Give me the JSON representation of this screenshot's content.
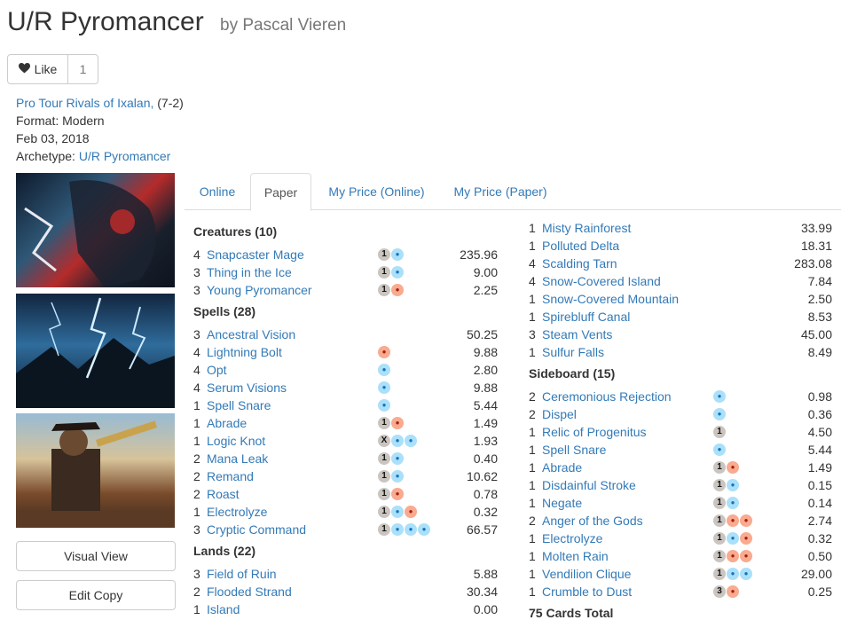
{
  "deck": {
    "title": "U/R Pyromancer",
    "byline": "by Pascal Vieren",
    "like_label": "Like",
    "like_count": "1"
  },
  "meta": {
    "event": "Pro Tour Rivals of Ixalan,",
    "record": "(7-2)",
    "format": "Format: Modern",
    "date": "Feb 03, 2018",
    "archetype_label": "Archetype:",
    "archetype": "U/R Pyromancer"
  },
  "sidebar": {
    "visual_view": "Visual View",
    "edit_copy": "Edit Copy"
  },
  "tabs": [
    "Online",
    "Paper",
    "My Price (Online)",
    "My Price (Paper)"
  ],
  "left_column": [
    {
      "title": "Creatures (10)",
      "cards": [
        {
          "qty": "4",
          "name": "Snapcaster Mage",
          "price": "235.96",
          "mana": [
            {
              "k": "g",
              "t": "1"
            },
            {
              "k": "u",
              "t": "💧"
            }
          ]
        },
        {
          "qty": "3",
          "name": "Thing in the Ice",
          "price": "9.00",
          "mana": [
            {
              "k": "g",
              "t": "1"
            },
            {
              "k": "u",
              "t": "💧"
            }
          ]
        },
        {
          "qty": "3",
          "name": "Young Pyromancer",
          "price": "2.25",
          "mana": [
            {
              "k": "g",
              "t": "1"
            },
            {
              "k": "r",
              "t": "🔥"
            }
          ]
        }
      ]
    },
    {
      "title": "Spells (28)",
      "cards": [
        {
          "qty": "3",
          "name": "Ancestral Vision",
          "price": "50.25",
          "mana": []
        },
        {
          "qty": "4",
          "name": "Lightning Bolt",
          "price": "9.88",
          "mana": [
            {
              "k": "r",
              "t": "🔥"
            }
          ]
        },
        {
          "qty": "4",
          "name": "Opt",
          "price": "2.80",
          "mana": [
            {
              "k": "u",
              "t": "💧"
            }
          ]
        },
        {
          "qty": "4",
          "name": "Serum Visions",
          "price": "9.88",
          "mana": [
            {
              "k": "u",
              "t": "💧"
            }
          ]
        },
        {
          "qty": "1",
          "name": "Spell Snare",
          "price": "5.44",
          "mana": [
            {
              "k": "u",
              "t": "💧"
            }
          ]
        },
        {
          "qty": "1",
          "name": "Abrade",
          "price": "1.49",
          "mana": [
            {
              "k": "g",
              "t": "1"
            },
            {
              "k": "r",
              "t": "🔥"
            }
          ]
        },
        {
          "qty": "1",
          "name": "Logic Knot",
          "price": "1.93",
          "mana": [
            {
              "k": "g",
              "t": "X"
            },
            {
              "k": "u",
              "t": "💧"
            },
            {
              "k": "u",
              "t": "💧"
            }
          ]
        },
        {
          "qty": "2",
          "name": "Mana Leak",
          "price": "0.40",
          "mana": [
            {
              "k": "g",
              "t": "1"
            },
            {
              "k": "u",
              "t": "💧"
            }
          ]
        },
        {
          "qty": "2",
          "name": "Remand",
          "price": "10.62",
          "mana": [
            {
              "k": "g",
              "t": "1"
            },
            {
              "k": "u",
              "t": "💧"
            }
          ]
        },
        {
          "qty": "2",
          "name": "Roast",
          "price": "0.78",
          "mana": [
            {
              "k": "g",
              "t": "1"
            },
            {
              "k": "r",
              "t": "🔥"
            }
          ]
        },
        {
          "qty": "1",
          "name": "Electrolyze",
          "price": "0.32",
          "mana": [
            {
              "k": "g",
              "t": "1"
            },
            {
              "k": "u",
              "t": "💧"
            },
            {
              "k": "r",
              "t": "🔥"
            }
          ]
        },
        {
          "qty": "3",
          "name": "Cryptic Command",
          "price": "66.57",
          "mana": [
            {
              "k": "g",
              "t": "1"
            },
            {
              "k": "u",
              "t": "💧"
            },
            {
              "k": "u",
              "t": "💧"
            },
            {
              "k": "u",
              "t": "💧"
            }
          ]
        }
      ]
    },
    {
      "title": "Lands (22)",
      "cards": [
        {
          "qty": "3",
          "name": "Field of Ruin",
          "price": "5.88",
          "mana": []
        },
        {
          "qty": "2",
          "name": "Flooded Strand",
          "price": "30.34",
          "mana": []
        },
        {
          "qty": "1",
          "name": "Island",
          "price": "0.00",
          "mana": []
        }
      ]
    }
  ],
  "right_column": [
    {
      "title": "",
      "cards": [
        {
          "qty": "1",
          "name": "Misty Rainforest",
          "price": "33.99",
          "mana": []
        },
        {
          "qty": "1",
          "name": "Polluted Delta",
          "price": "18.31",
          "mana": []
        },
        {
          "qty": "4",
          "name": "Scalding Tarn",
          "price": "283.08",
          "mana": []
        },
        {
          "qty": "4",
          "name": "Snow-Covered Island",
          "price": "7.84",
          "mana": []
        },
        {
          "qty": "1",
          "name": "Snow-Covered Mountain",
          "price": "2.50",
          "mana": []
        },
        {
          "qty": "1",
          "name": "Spirebluff Canal",
          "price": "8.53",
          "mana": []
        },
        {
          "qty": "3",
          "name": "Steam Vents",
          "price": "45.00",
          "mana": []
        },
        {
          "qty": "1",
          "name": "Sulfur Falls",
          "price": "8.49",
          "mana": []
        }
      ]
    },
    {
      "title": "Sideboard (15)",
      "cards": [
        {
          "qty": "2",
          "name": "Ceremonious Rejection",
          "price": "0.98",
          "mana": [
            {
              "k": "u",
              "t": "💧"
            }
          ]
        },
        {
          "qty": "2",
          "name": "Dispel",
          "price": "0.36",
          "mana": [
            {
              "k": "u",
              "t": "💧"
            }
          ]
        },
        {
          "qty": "1",
          "name": "Relic of Progenitus",
          "price": "4.50",
          "mana": [
            {
              "k": "g",
              "t": "1"
            }
          ]
        },
        {
          "qty": "1",
          "name": "Spell Snare",
          "price": "5.44",
          "mana": [
            {
              "k": "u",
              "t": "💧"
            }
          ]
        },
        {
          "qty": "1",
          "name": "Abrade",
          "price": "1.49",
          "mana": [
            {
              "k": "g",
              "t": "1"
            },
            {
              "k": "r",
              "t": "🔥"
            }
          ]
        },
        {
          "qty": "1",
          "name": "Disdainful Stroke",
          "price": "0.15",
          "mana": [
            {
              "k": "g",
              "t": "1"
            },
            {
              "k": "u",
              "t": "💧"
            }
          ]
        },
        {
          "qty": "1",
          "name": "Negate",
          "price": "0.14",
          "mana": [
            {
              "k": "g",
              "t": "1"
            },
            {
              "k": "u",
              "t": "💧"
            }
          ]
        },
        {
          "qty": "2",
          "name": "Anger of the Gods",
          "price": "2.74",
          "mana": [
            {
              "k": "g",
              "t": "1"
            },
            {
              "k": "r",
              "t": "🔥"
            },
            {
              "k": "r",
              "t": "🔥"
            }
          ]
        },
        {
          "qty": "1",
          "name": "Electrolyze",
          "price": "0.32",
          "mana": [
            {
              "k": "g",
              "t": "1"
            },
            {
              "k": "u",
              "t": "💧"
            },
            {
              "k": "r",
              "t": "🔥"
            }
          ]
        },
        {
          "qty": "1",
          "name": "Molten Rain",
          "price": "0.50",
          "mana": [
            {
              "k": "g",
              "t": "1"
            },
            {
              "k": "r",
              "t": "🔥"
            },
            {
              "k": "r",
              "t": "🔥"
            }
          ]
        },
        {
          "qty": "1",
          "name": "Vendilion Clique",
          "price": "29.00",
          "mana": [
            {
              "k": "g",
              "t": "1"
            },
            {
              "k": "u",
              "t": "💧"
            },
            {
              "k": "u",
              "t": "💧"
            }
          ]
        },
        {
          "qty": "1",
          "name": "Crumble to Dust",
          "price": "0.25",
          "mana": [
            {
              "k": "g",
              "t": "3"
            },
            {
              "k": "r",
              "t": "🔥"
            }
          ]
        }
      ]
    },
    {
      "title": "75 Cards Total",
      "cards": []
    }
  ]
}
